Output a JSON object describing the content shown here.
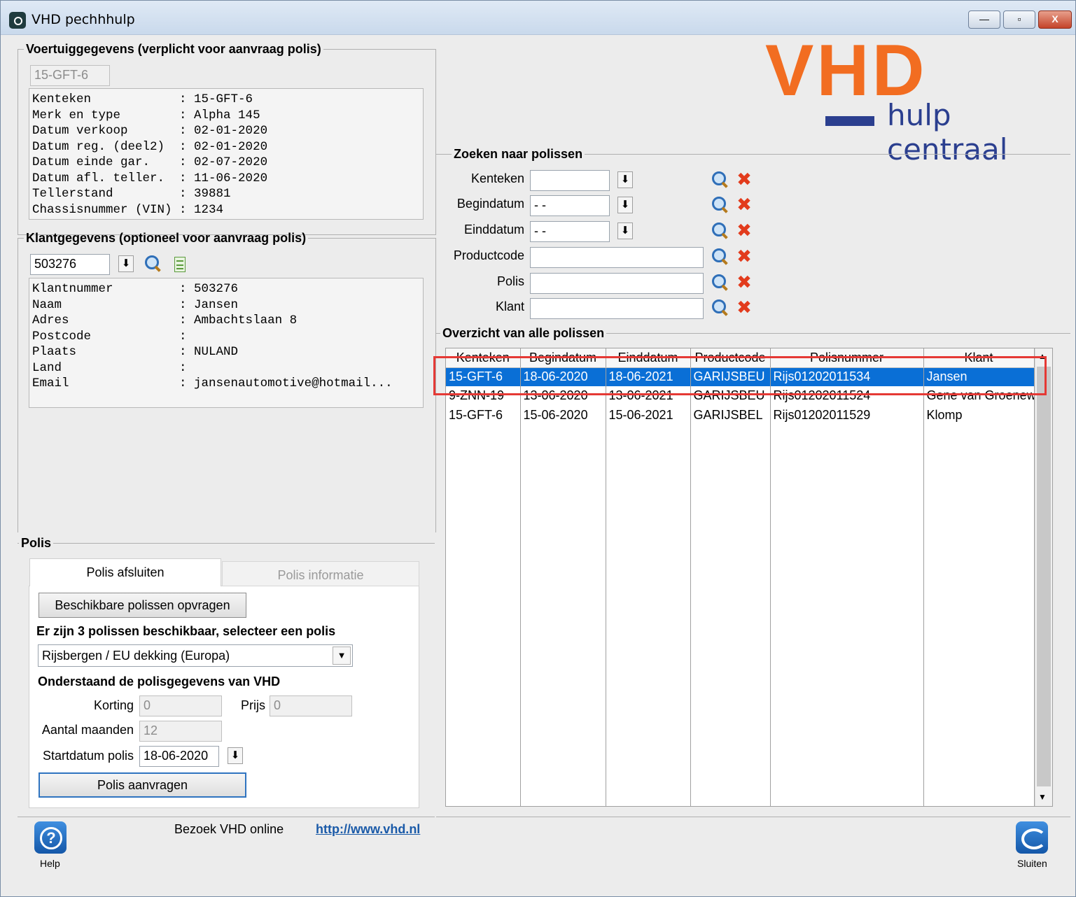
{
  "window": {
    "title": "VHD pechhhulp",
    "minimize": "—",
    "maximize": "▫",
    "close": "X"
  },
  "logo": {
    "brand": "VHD",
    "tagline": "hulp centraal",
    "brand_color": "#f26d21",
    "tagline_color": "#2b3f8f"
  },
  "vehicle": {
    "legend": "Voertuiggegevens (verplicht voor aanvraag polis)",
    "kenteken_input": "15-GFT-6",
    "info": [
      {
        "label": "Kenteken            ",
        "value": ": 15-GFT-6"
      },
      {
        "label": "Merk en type        ",
        "value": ": Alpha 145"
      },
      {
        "label": "Datum verkoop       ",
        "value": ": 02-01-2020"
      },
      {
        "label": "Datum reg. (deel2)  ",
        "value": ": 02-01-2020"
      },
      {
        "label": "Datum einde gar.    ",
        "value": ": 02-07-2020"
      },
      {
        "label": "Datum afl. teller.  ",
        "value": ": 11-06-2020"
      },
      {
        "label": "Tellerstand         ",
        "value": ": 39881"
      },
      {
        "label": "Chassisnummer (VIN) ",
        "value": ": 1234"
      }
    ]
  },
  "customer": {
    "legend": "Klantgegevens (optioneel voor aanvraag polis)",
    "klant_input": "503276",
    "info": [
      {
        "label": "Klantnummer         ",
        "value": ": 503276"
      },
      {
        "label": "Naam                ",
        "value": ": Jansen"
      },
      {
        "label": "Adres               ",
        "value": ": Ambachtslaan 8"
      },
      {
        "label": "Postcode            ",
        "value": ":"
      },
      {
        "label": "Plaats              ",
        "value": ": NULAND"
      },
      {
        "label": "Land                ",
        "value": ":"
      },
      {
        "label": "Email               ",
        "value": ": jansenautomotive@hotmail..."
      }
    ]
  },
  "polis": {
    "legend": "Polis",
    "tab_active": "Polis afsluiten",
    "tab_inactive": "Polis informatie",
    "btn_beschikbaar": "Beschikbare polissen opvragen",
    "available_text": "Er zijn 3 polissen beschikbaar, selecteer een polis",
    "selected_polis": "Rijsbergen / EU dekking (Europa)",
    "subheading": "Onderstaand de polisgegevens van VHD",
    "korting_label": "Korting",
    "korting_value": "0",
    "prijs_label": "Prijs",
    "prijs_value": "0",
    "maanden_label": "Aantal maanden",
    "maanden_value": "12",
    "startdatum_label": "Startdatum polis",
    "startdatum_value": "18-06-2020",
    "btn_aanvragen": "Polis aanvragen"
  },
  "search": {
    "legend": "Zoeken naar polissen",
    "kenteken_label": "Kenteken",
    "kenteken_value": "",
    "begindatum_label": "Begindatum",
    "begindatum_value": "- -",
    "einddatum_label": "Einddatum",
    "einddatum_value": "- -",
    "productcode_label": "Productcode",
    "productcode_value": "",
    "polis_label": "Polis",
    "polis_value": "",
    "klant_label": "Klant",
    "klant_value": ""
  },
  "overview": {
    "legend": "Overzicht van alle polissen",
    "columns": [
      "Kenteken",
      "Begindatum",
      "Einddatum",
      "Productcode",
      "Polisnummer",
      "Klant"
    ],
    "rows": [
      [
        "15-GFT-6",
        "18-06-2020",
        "18-06-2021",
        "GARIJSBEU",
        "Rijs01202011534",
        "Jansen"
      ],
      [
        "9-ZNN-19",
        "13-06-2020",
        "13-06-2021",
        "GARIJSBEU",
        "Rijs01202011524",
        "Gene van Groenew"
      ],
      [
        "15-GFT-6",
        "15-06-2020",
        "15-06-2021",
        "GARIJSBEL",
        "Rijs01202011529",
        "Klomp"
      ]
    ],
    "highlight_color": "#e53935",
    "selected_color": "#0a6fd6"
  },
  "footer": {
    "help_label": "Help",
    "visit_text": "Bezoek VHD online",
    "url": "http://www.vhd.nl",
    "close_label": "Sluiten"
  }
}
